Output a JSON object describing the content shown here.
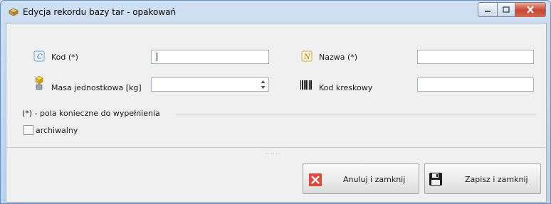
{
  "window": {
    "title": "Edycja rekordu bazy tar - opakowań"
  },
  "form": {
    "kod_label": "Kod (*)",
    "kod_value": "",
    "nazwa_label": "Nazwa (*)",
    "nazwa_value": "",
    "masa_label": "Masa jednostkowa [kg]",
    "masa_value": "",
    "kod_kreskowy_label": "Kod kreskowy",
    "kod_kreskowy_value": "",
    "required_note": "(*) - pola konieczne do wypełnienia",
    "archiwalny_label": "archiwalny",
    "archiwalny_checked": false
  },
  "buttons": {
    "cancel_label": "Anuluj i zamknij",
    "save_label": "Zapisz i zamknij"
  },
  "colors": {
    "cancel_red": "#e04a3a",
    "title_bar": "#b9d1ec"
  }
}
